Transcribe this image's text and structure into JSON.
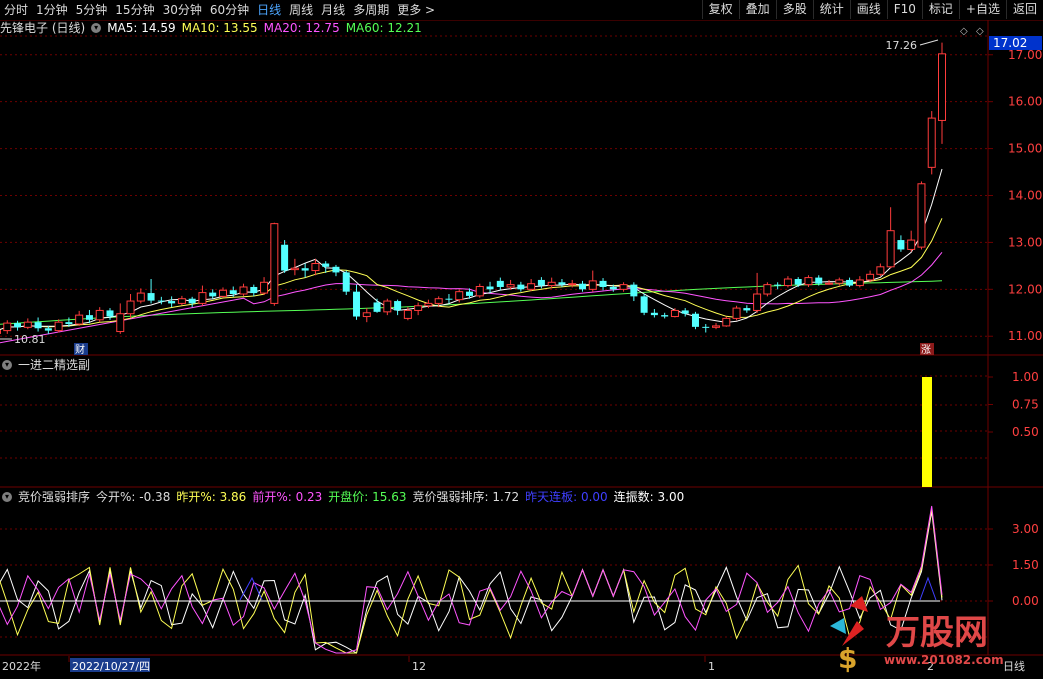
{
  "toolbar": {
    "periods": [
      "分时",
      "1分钟",
      "5分钟",
      "15分钟",
      "30分钟",
      "60分钟",
      "日线",
      "周线",
      "月线",
      "多周期",
      "更多 >"
    ],
    "active_period": "日线",
    "right_buttons": [
      "复权",
      "叠加",
      "多股",
      "统计",
      "画线",
      "F10",
      "标记",
      "+自选",
      "返回"
    ]
  },
  "main_panel": {
    "title": "先锋电子 (日线)",
    "ma": [
      {
        "label": "MA5: 14.59",
        "color": "#ffffff"
      },
      {
        "label": "MA10: 13.55",
        "color": "#ffff55"
      },
      {
        "label": "MA20: 12.75",
        "color": "#ff55ff"
      },
      {
        "label": "MA60: 12.21",
        "color": "#55ff55"
      }
    ],
    "y_ticks": [
      "17.00",
      "16.00",
      "15.00",
      "14.00",
      "13.00",
      "12.00",
      "11.00"
    ],
    "current_price_badge": "17.02",
    "high_label": "17.26",
    "low_label": "10.81",
    "cai_marker": "财",
    "zhang_marker": "涨",
    "diamond_icons": [
      "◇",
      "◇"
    ]
  },
  "sub_panel1": {
    "title": "一进二精选副",
    "y_ticks": [
      "1.00",
      "0.75",
      "0.50"
    ],
    "bar_value": 1.0
  },
  "sub_panel2": {
    "items": [
      {
        "label": "竞价强弱排序",
        "color": "#dcdcdc"
      },
      {
        "label": "今开%: -0.38",
        "color": "#dcdcdc"
      },
      {
        "label": "昨开%: 3.86",
        "color": "#ffff55"
      },
      {
        "label": "前开%: 0.23",
        "color": "#ff55ff"
      },
      {
        "label": "开盘价: 15.63",
        "color": "#55ff55"
      },
      {
        "label": "竞价强弱排序: 1.72",
        "color": "#dcdcdc"
      },
      {
        "label": "昨天连板: 0.00",
        "color": "#3f3fff"
      },
      {
        "label": "连振数: 3.00",
        "color": "#ffffff"
      }
    ],
    "y_ticks": [
      "3.00",
      "1.50",
      "0.00"
    ]
  },
  "time_axis": {
    "labels": [
      {
        "text": "2022年",
        "x": 2
      },
      {
        "text": "2022/10/27/四",
        "x": 72
      },
      {
        "text": "12",
        "x": 412
      },
      {
        "text": "1",
        "x": 708
      },
      {
        "text": "2",
        "x": 927
      }
    ],
    "period_label": "日线"
  },
  "watermark": {
    "site": "万股网",
    "url": "www.201082.com"
  },
  "colors": {
    "up": "#ff3c3c",
    "down": "#54ffff",
    "grid": "#6e0000",
    "ma5": "#ffffff",
    "ma10": "#ffff55",
    "ma20": "#ff55ff",
    "ma60": "#55ff55"
  },
  "chart_data": {
    "type": "line",
    "title": "先锋电子 (日线)",
    "ylim": [
      10.6,
      17.4
    ],
    "candles": [
      [
        11.06,
        11.12,
        10.95,
        11.18
      ],
      [
        11.12,
        11.28,
        11.05,
        11.34
      ],
      [
        11.28,
        11.19,
        11.12,
        11.33
      ],
      [
        11.19,
        11.3,
        11.15,
        11.38
      ],
      [
        11.3,
        11.17,
        11.1,
        11.4
      ],
      [
        11.17,
        11.12,
        11.05,
        11.22
      ],
      [
        11.12,
        11.3,
        11.08,
        11.36
      ],
      [
        11.3,
        11.26,
        11.2,
        11.4
      ],
      [
        11.26,
        11.45,
        11.22,
        11.54
      ],
      [
        11.45,
        11.35,
        11.28,
        11.56
      ],
      [
        11.35,
        11.55,
        11.3,
        11.62
      ],
      [
        11.55,
        11.42,
        11.35,
        11.6
      ],
      [
        11.1,
        11.48,
        11.05,
        11.7
      ],
      [
        11.48,
        11.75,
        11.4,
        11.9
      ],
      [
        11.75,
        11.92,
        11.7,
        12.02
      ],
      [
        11.92,
        11.76,
        11.7,
        12.22
      ],
      [
        11.76,
        11.75,
        11.68,
        11.84
      ],
      [
        11.75,
        11.7,
        11.62,
        11.85
      ],
      [
        11.7,
        11.8,
        11.66,
        11.86
      ],
      [
        11.8,
        11.7,
        11.62,
        11.84
      ],
      [
        11.7,
        11.93,
        11.65,
        12.08
      ],
      [
        11.93,
        11.85,
        11.8,
        12.0
      ],
      [
        11.85,
        11.98,
        11.82,
        12.04
      ],
      [
        11.98,
        11.9,
        11.84,
        12.06
      ],
      [
        11.9,
        12.05,
        11.86,
        12.12
      ],
      [
        12.05,
        11.92,
        11.85,
        12.1
      ],
      [
        11.92,
        12.15,
        11.88,
        12.26
      ],
      [
        11.7,
        13.4,
        11.65,
        13.42
      ],
      [
        12.95,
        12.4,
        12.35,
        13.05
      ],
      [
        12.42,
        12.45,
        12.3,
        12.65
      ],
      [
        12.45,
        12.4,
        12.25,
        12.55
      ],
      [
        12.4,
        12.55,
        12.3,
        12.65
      ],
      [
        12.55,
        12.48,
        12.35,
        12.6
      ],
      [
        12.48,
        12.36,
        12.28,
        12.52
      ],
      [
        12.36,
        11.95,
        11.88,
        12.4
      ],
      [
        11.95,
        11.42,
        11.35,
        12.1
      ],
      [
        11.42,
        11.5,
        11.3,
        11.6
      ],
      [
        11.72,
        11.52,
        11.5,
        11.8
      ],
      [
        11.52,
        11.75,
        11.45,
        11.8
      ],
      [
        11.75,
        11.55,
        11.45,
        11.78
      ],
      [
        11.38,
        11.55,
        11.34,
        11.62
      ],
      [
        11.55,
        11.65,
        11.45,
        11.72
      ],
      [
        11.65,
        11.7,
        11.6,
        11.78
      ],
      [
        11.7,
        11.8,
        11.62,
        11.85
      ],
      [
        11.8,
        11.78,
        11.7,
        11.9
      ],
      [
        11.78,
        11.95,
        11.72,
        12.0
      ],
      [
        11.95,
        11.86,
        11.8,
        12.02
      ],
      [
        11.86,
        12.06,
        11.82,
        12.12
      ],
      [
        12.06,
        12.0,
        11.92,
        12.16
      ],
      [
        12.18,
        12.05,
        11.98,
        12.25
      ],
      [
        12.05,
        12.1,
        12.0,
        12.2
      ],
      [
        12.1,
        12.0,
        11.95,
        12.16
      ],
      [
        12.0,
        12.12,
        11.96,
        12.22
      ],
      [
        12.2,
        12.08,
        12.02,
        12.26
      ],
      [
        12.08,
        12.15,
        12.02,
        12.25
      ],
      [
        12.15,
        12.1,
        12.05,
        12.22
      ],
      [
        12.1,
        12.12,
        12.04,
        12.2
      ],
      [
        12.12,
        12.0,
        11.95,
        12.18
      ],
      [
        12.0,
        12.18,
        11.95,
        12.4
      ],
      [
        12.18,
        12.05,
        11.98,
        12.24
      ],
      [
        12.05,
        12.0,
        11.95,
        12.1
      ],
      [
        12.0,
        12.1,
        11.95,
        12.15
      ],
      [
        12.1,
        11.85,
        11.75,
        12.15
      ],
      [
        11.85,
        11.5,
        11.45,
        11.9
      ],
      [
        11.5,
        11.45,
        11.4,
        11.58
      ],
      [
        11.45,
        11.42,
        11.38,
        11.5
      ],
      [
        11.42,
        11.55,
        11.4,
        11.6
      ],
      [
        11.55,
        11.48,
        11.42,
        11.6
      ],
      [
        11.48,
        11.2,
        11.15,
        11.52
      ],
      [
        11.2,
        11.19,
        11.08,
        11.26
      ],
      [
        11.19,
        11.22,
        11.15,
        11.28
      ],
      [
        11.22,
        11.38,
        11.2,
        11.42
      ],
      [
        11.38,
        11.6,
        11.34,
        11.65
      ],
      [
        11.6,
        11.55,
        11.5,
        11.66
      ],
      [
        11.55,
        11.9,
        11.5,
        12.35
      ],
      [
        11.9,
        12.1,
        11.85,
        12.15
      ],
      [
        12.1,
        12.08,
        12.0,
        12.15
      ],
      [
        12.08,
        12.22,
        12.04,
        12.28
      ],
      [
        12.22,
        12.1,
        12.05,
        12.26
      ],
      [
        12.1,
        12.25,
        12.05,
        12.3
      ],
      [
        12.25,
        12.12,
        12.08,
        12.3
      ],
      [
        12.12,
        12.13,
        12.1,
        12.2
      ],
      [
        12.13,
        12.2,
        12.08,
        12.25
      ],
      [
        12.2,
        12.08,
        12.05,
        12.25
      ],
      [
        12.08,
        12.2,
        12.04,
        12.28
      ],
      [
        12.2,
        12.32,
        12.15,
        12.4
      ],
      [
        12.32,
        12.48,
        12.28,
        12.55
      ],
      [
        12.48,
        13.25,
        12.45,
        13.75
      ],
      [
        13.05,
        12.85,
        12.8,
        13.15
      ],
      [
        12.85,
        13.05,
        12.8,
        13.25
      ],
      [
        12.9,
        14.25,
        12.85,
        14.3
      ],
      [
        14.6,
        15.65,
        14.45,
        15.8
      ],
      [
        15.6,
        17.02,
        15.1,
        17.26
      ]
    ],
    "ma5_last": 14.59,
    "ma10_last": 13.55,
    "ma20_last": 12.75,
    "ma60_last": 12.21
  }
}
